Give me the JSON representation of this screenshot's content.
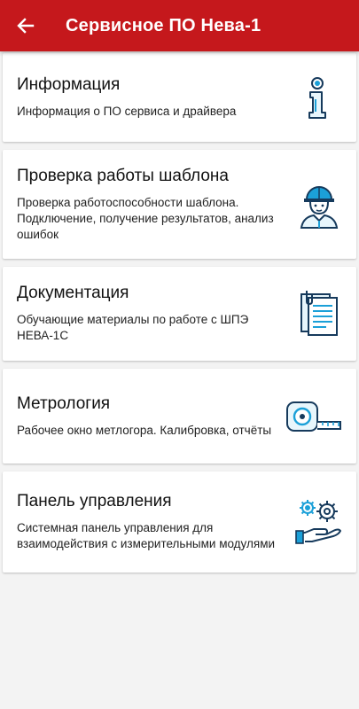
{
  "appbar": {
    "title": "Сервисное ПО Нева-1"
  },
  "menu": [
    {
      "title": "Информация",
      "description": "Информация о ПО сервиса и драйвера",
      "icon": "info-icon"
    },
    {
      "title": "Проверка работы шаблона",
      "description": "Проверка работоспособности шаблона. Подключение, получение результатов, анализ ошибок",
      "icon": "engineer-icon"
    },
    {
      "title": "Документация",
      "description": "Обучающие материалы по работе с ШПЭ НЕВА-1С",
      "icon": "documents-icon"
    },
    {
      "title": "Метрология",
      "description": "Рабочее окно метлогора. Калибровка, отчёты",
      "icon": "tape-measure-icon"
    },
    {
      "title": "Панель управления",
      "description": "Системная панель управления для взаимодействия с измерительными модулями",
      "icon": "gears-hand-icon"
    }
  ],
  "colors": {
    "appbar": "#c5181c",
    "icon_accent": "#1ba0d8",
    "icon_dark": "#163a5c"
  }
}
